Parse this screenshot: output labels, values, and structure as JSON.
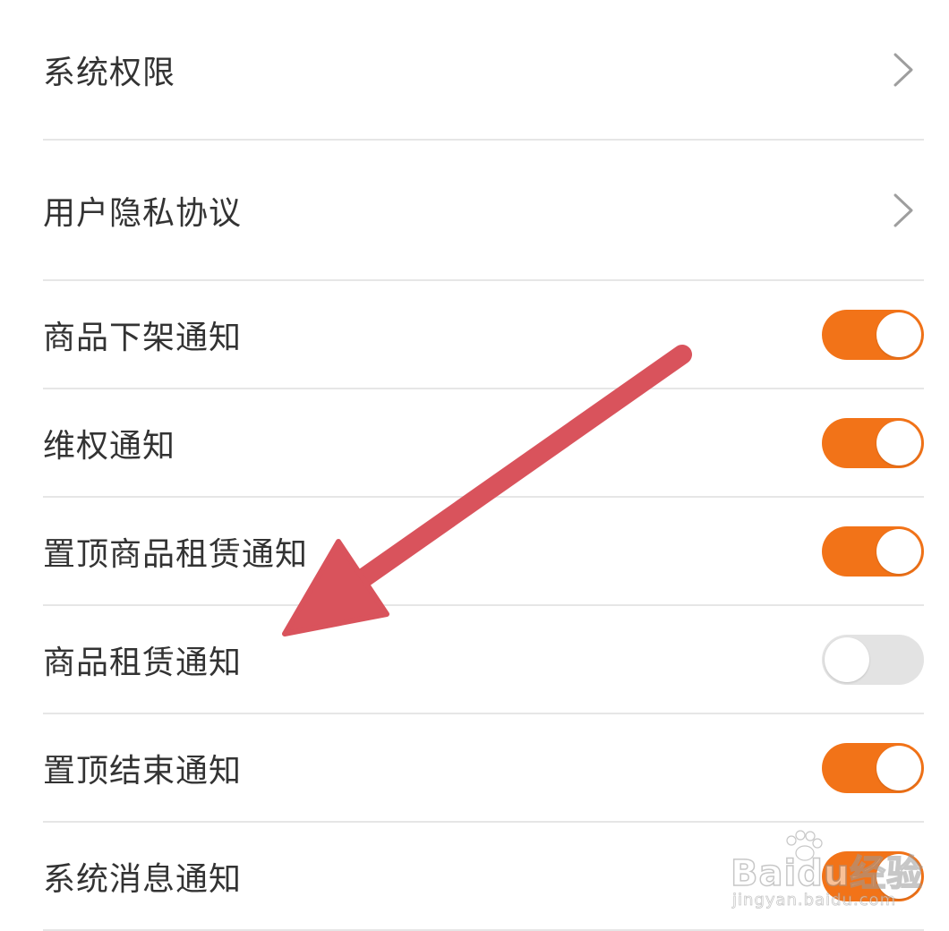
{
  "settings": {
    "items": [
      {
        "label": "系统权限",
        "control": "chevron"
      },
      {
        "label": "用户隐私协议",
        "control": "chevron"
      },
      {
        "label": "商品下架通知",
        "control": "toggle",
        "on": true
      },
      {
        "label": "维权通知",
        "control": "toggle",
        "on": true
      },
      {
        "label": "置顶商品租赁通知",
        "control": "toggle",
        "on": true
      },
      {
        "label": "商品租赁通知",
        "control": "toggle",
        "on": false
      },
      {
        "label": "置顶结束通知",
        "control": "toggle",
        "on": true
      },
      {
        "label": "系统消息通知",
        "control": "toggle",
        "on": true
      }
    ]
  },
  "colors": {
    "toggle_on": "#f27318",
    "toggle_off": "#e3e3e3",
    "annotation_arrow": "#d9535c"
  },
  "annotation": {
    "icon": "arrow-pointer-icon"
  },
  "watermark": {
    "brand": "Baidu经验",
    "url": "jingyan.baidu.com"
  }
}
